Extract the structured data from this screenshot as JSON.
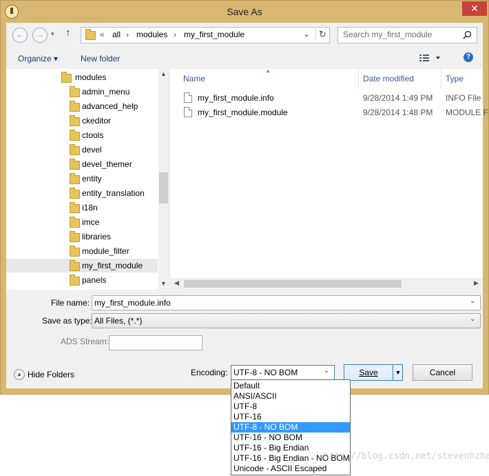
{
  "window": {
    "title": "Save As",
    "close_glyph": "✕"
  },
  "nav": {
    "back": "←",
    "forward": "→",
    "up": "↑"
  },
  "address": {
    "path": [
      "«",
      "all",
      "modules",
      "my_first_module"
    ],
    "separator": "›",
    "refresh": "↻",
    "dropdown": "⌄"
  },
  "search": {
    "placeholder": "Search my_first_module",
    "icon": "search-icon"
  },
  "toolbar": {
    "organize": "Organize ▾",
    "new_folder": "New folder",
    "view": "view-icon",
    "help": "?"
  },
  "tree": {
    "items": [
      "modules",
      "admin_menu",
      "advanced_help",
      "ckeditor",
      "ctools",
      "devel",
      "devel_themer",
      "entity",
      "entity_translation",
      "i18n",
      "imce",
      "libraries",
      "module_filter",
      "my_first_module",
      "panels"
    ],
    "selected": "my_first_module"
  },
  "files": {
    "columns": {
      "name": "Name",
      "date": "Date modified",
      "type": "Type"
    },
    "rows": [
      {
        "name": "my_first_module.info",
        "date": "9/28/2014 1:49 PM",
        "type": "INFO File"
      },
      {
        "name": "my_first_module.module",
        "date": "9/28/2014 1:48 PM",
        "type": "MODULE F"
      }
    ]
  },
  "form": {
    "file_name_label": "File name:",
    "file_name": "my_first_module.info",
    "save_type_label": "Save as type:",
    "save_type": "All Files, (*.*)",
    "ads_label": "ADS Stream:",
    "ads_value": "",
    "hide_folders": "Hide Folders",
    "encoding_label": "Encoding:",
    "encoding": "UTF-8 - NO BOM",
    "save": "Save",
    "cancel": "Cancel"
  },
  "encoding_options": [
    "Default",
    "ANSI/ASCII",
    "UTF-8",
    "UTF-16",
    "UTF-8 - NO BOM",
    "UTF-16  - NO BOM",
    "UTF-16 - Big Endian",
    "UTF-16 - Big Endian  - NO BOM",
    "Unicode - ASCII Escaped"
  ],
  "encoding_selected_index": 4,
  "watermark": "http://blog.csdn.net/stevenhzhang",
  "colors": {
    "frame": "#d9b770",
    "selection": "#3399ff",
    "close": "#c7423a"
  }
}
